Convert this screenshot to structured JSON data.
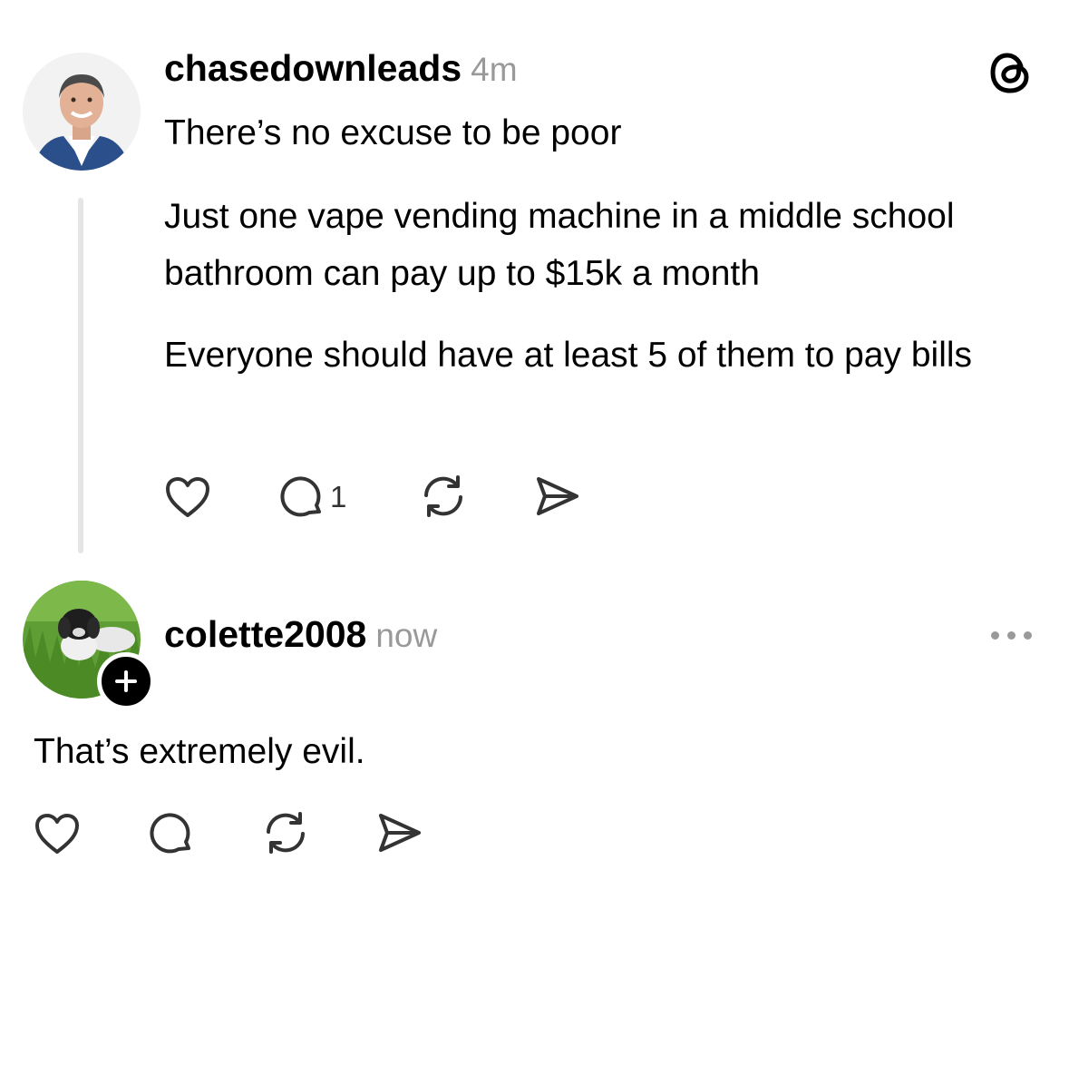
{
  "post": {
    "username": "chasedownleads",
    "time": "4m",
    "paragraphs": [
      "There’s no excuse to be poor",
      "Just one vape vending machine in a middle school bathroom can pay up to $15k a month",
      "Everyone should have at least 5 of them to pay bills"
    ],
    "reply_count": "1",
    "icons": {
      "like": "heart-icon",
      "reply": "comment-icon",
      "repost": "repost-icon",
      "share": "send-icon",
      "app": "threads-logo-icon"
    }
  },
  "reply": {
    "username": "colette2008",
    "time": "now",
    "text": "That’s extremely evil.",
    "icons": {
      "like": "heart-icon",
      "reply": "comment-icon",
      "repost": "repost-icon",
      "share": "send-icon",
      "more": "more-icon",
      "follow": "plus-icon"
    }
  },
  "colors": {
    "text": "#000000",
    "muted": "#999999",
    "thread_line": "#e5e5e5",
    "icon": "#333333"
  }
}
